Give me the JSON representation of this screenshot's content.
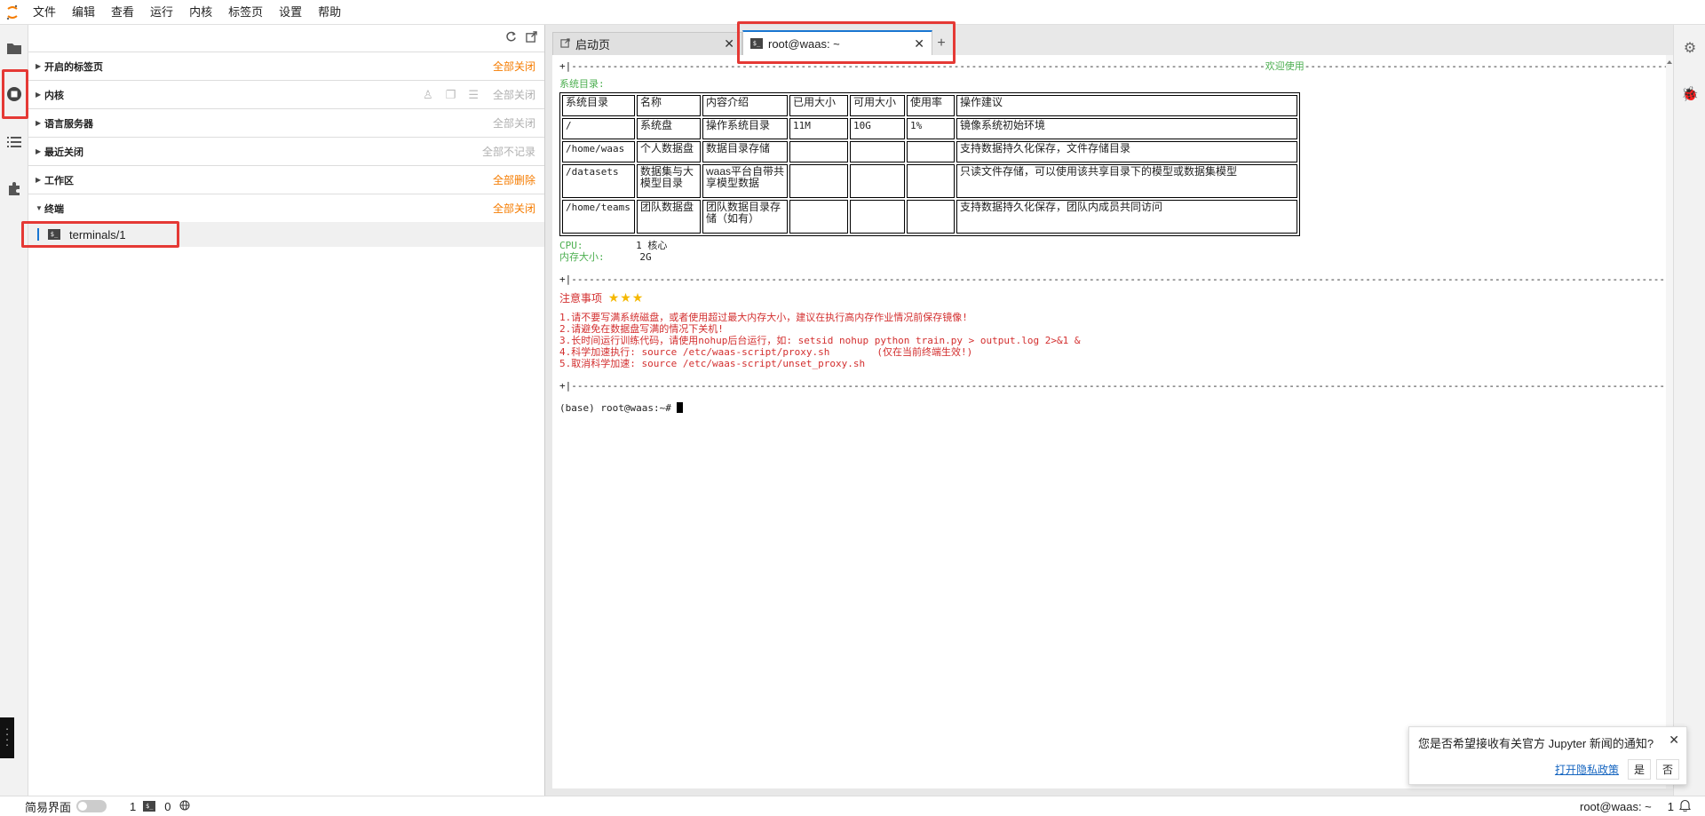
{
  "menu": {
    "items": [
      "文件",
      "编辑",
      "查看",
      "运行",
      "内核",
      "标签页",
      "设置",
      "帮助"
    ]
  },
  "sidebar": {
    "sections": {
      "open_tabs": {
        "title": "开启的标签页",
        "action": "全部关闭"
      },
      "kernels": {
        "title": "内核",
        "action": "全部关闭"
      },
      "language_servers": {
        "title": "语言服务器",
        "action": "全部关闭"
      },
      "recently_closed": {
        "title": "最近关闭",
        "action": "全部不记录"
      },
      "workspaces": {
        "title": "工作区",
        "action": "全部删除"
      },
      "terminals": {
        "title": "终端",
        "action": "全部关闭"
      }
    },
    "terminal_item": {
      "label": "terminals/1",
      "icon_text": "$_"
    }
  },
  "tabs": {
    "launcher": {
      "label": "启动页"
    },
    "terminal": {
      "label": "root@waas: ~"
    }
  },
  "terminal": {
    "divider_top_left": "+|----------------------------------------------------------------------------------------------------------------------",
    "welcome": "欢迎使用",
    "divider_top_right": "--------------------------------------------------------------------------------------------------------------------------------------------------------------------------------------------------------------------------------------------------------------------------------------------------+|",
    "sys_dir_heading": "系统目录:",
    "table": {
      "headers": [
        "系统目录",
        "名称",
        "内容介绍",
        "已用大小",
        "可用大小",
        "使用率",
        "操作建议"
      ],
      "rows": [
        [
          "/",
          "系统盘",
          "操作系统目录",
          "11M",
          "10G",
          "1%",
          "镜像系统初始环境"
        ],
        [
          "/home/waas",
          "个人数据盘",
          "数据目录存储",
          "",
          "",
          "",
          "支持数据持久化保存，文件存储目录"
        ],
        [
          "/datasets",
          "数据集与大模型目录",
          "waas平台自带共享模型数据",
          "",
          "",
          "",
          "只读文件存储，可以使用该共享目录下的模型或数据集模型"
        ],
        [
          "/home/teams",
          "团队数据盘",
          "团队数据目录存储（如有）",
          "",
          "",
          "",
          "支持数据持久化保存，团队内成员共同访问"
        ]
      ]
    },
    "cpu_label": "CPU:",
    "cpu_value": "1 核心",
    "mem_label": "内存大小:",
    "mem_value": "2G",
    "divider_full": "+|-----------------------------------------------------------------------------------------------------------------------------------------------------------------------------------------------------------------------------------------------------------------------------------------+|",
    "notice_heading": "注意事项",
    "stars": "★★★",
    "notices": [
      "1.请不要写满系统磁盘，或者使用超过最大内存大小，建议在执行高内存作业情况前保存镜像!",
      "2.请避免在数据盘写满的情况下关机!",
      "3.长时间运行训练代码，请使用nohup后台运行，如: setsid nohup python train.py > output.log 2>&1 &",
      "4.科学加速执行: source /etc/waas-script/proxy.sh        (仅在当前终端生效!)",
      "5.取消科学加速: source /etc/waas-script/unset_proxy.sh"
    ],
    "prompt": "(base) root@waas:~# "
  },
  "statusbar": {
    "simple_mode": "简易界面",
    "kernels_count": "1",
    "terminals_count": "0",
    "right_label": "root@waas: ~",
    "right_count": "1"
  },
  "notification": {
    "message": "您是否希望接收有关官方 Jupyter 新闻的通知?",
    "link": "打开隐私政策",
    "yes": "是",
    "no": "否"
  },
  "colors": {
    "accent_orange": "#f57c00",
    "highlight_red": "#e53935",
    "welcome_green": "#4caf50",
    "notice_red": "#d32f2f"
  }
}
